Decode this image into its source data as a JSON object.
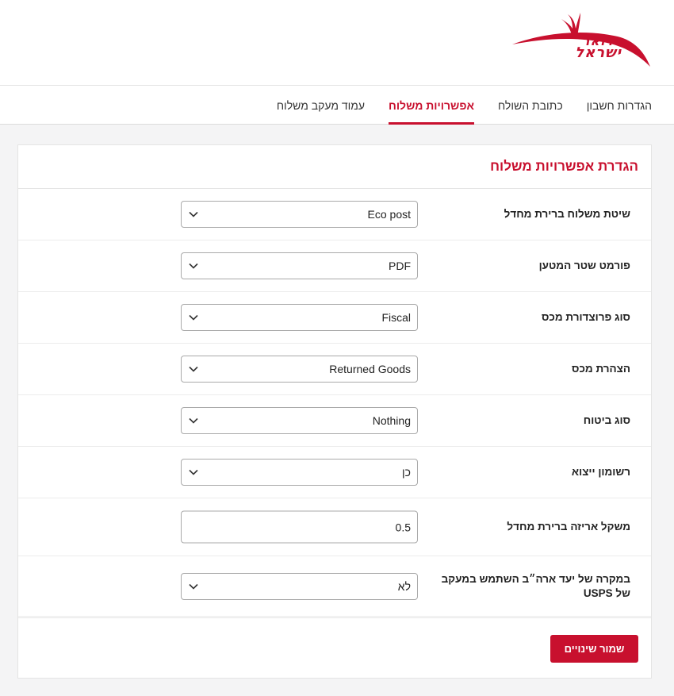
{
  "brand": {
    "logo_line1": "דואר",
    "logo_line2": "ישראל",
    "color": "#c8102e"
  },
  "tabs": [
    {
      "label": "הגדרות חשבון",
      "active": false
    },
    {
      "label": "כתובת השולח",
      "active": false
    },
    {
      "label": "אפשרויות משלוח",
      "active": true
    },
    {
      "label": "עמוד מעקב משלוח",
      "active": false
    }
  ],
  "card": {
    "title": "הגדרת אפשרויות משלוח",
    "fields": [
      {
        "label": "שיטת משלוח ברירת מחדל",
        "value": "Eco post",
        "type": "select"
      },
      {
        "label": "פורמט שטר המטען",
        "value": "PDF",
        "type": "select"
      },
      {
        "label": "סוג פרוצדורת מכס",
        "value": "Fiscal",
        "type": "select"
      },
      {
        "label": "הצהרת מכס",
        "value": "Returned Goods",
        "type": "select"
      },
      {
        "label": "סוג ביטוח",
        "value": "Nothing",
        "type": "select"
      },
      {
        "label": "רשומון ייצוא",
        "value": "כן",
        "type": "select"
      },
      {
        "label": "משקל אריזה ברירת מחדל",
        "value": "0.5",
        "type": "input"
      },
      {
        "label": "במקרה של יעד ארה״ב השתמש במעקב של USPS",
        "value": "לא",
        "type": "select"
      }
    ],
    "save_label": "שמור שינויים"
  },
  "icons": {
    "select_arrow": "chevron-down-icon"
  }
}
